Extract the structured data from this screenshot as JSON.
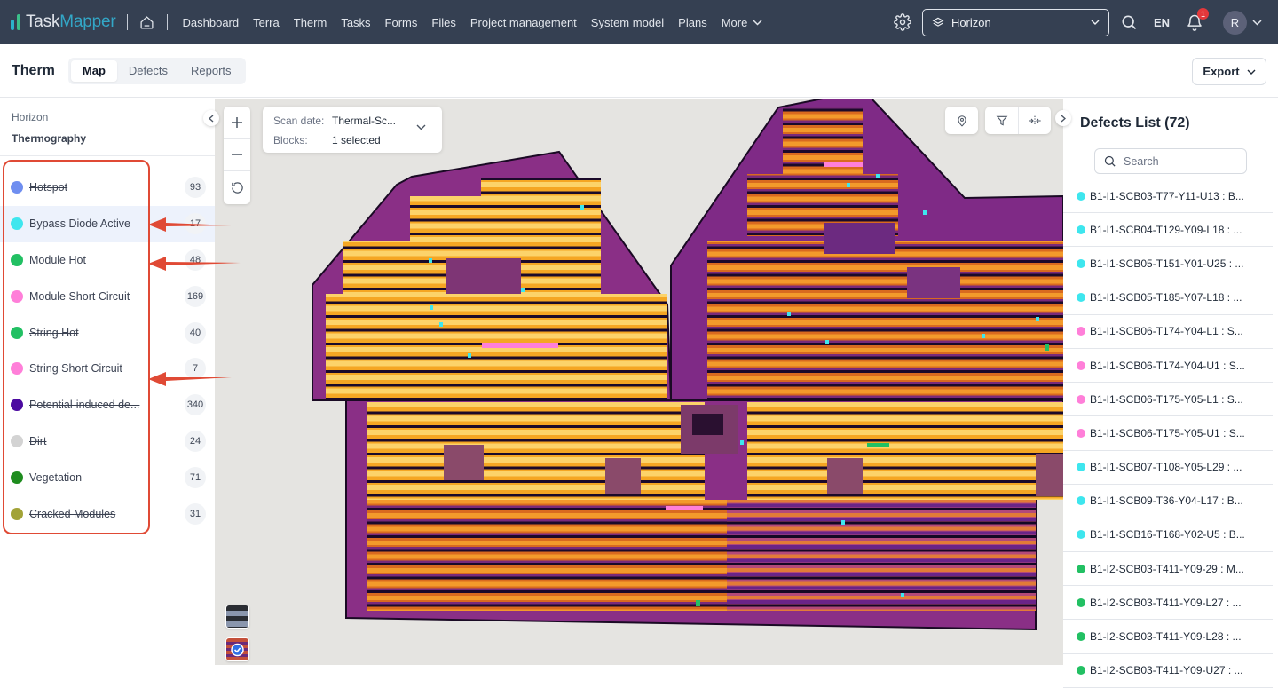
{
  "app": {
    "logo_primary": "Task",
    "logo_accent": "Mapper"
  },
  "nav": {
    "links": [
      "Dashboard",
      "Terra",
      "Therm",
      "Tasks",
      "Forms",
      "Files",
      "Project management",
      "System model",
      "Plans"
    ],
    "more_label": "More",
    "project_selector": "Horizon",
    "language": "EN",
    "notification_count": "1",
    "avatar_initial": "R"
  },
  "subheader": {
    "title": "Therm",
    "tabs": [
      {
        "label": "Map",
        "active": true
      },
      {
        "label": "Defects",
        "active": false
      },
      {
        "label": "Reports",
        "active": false
      }
    ],
    "export_label": "Export"
  },
  "left_panel": {
    "project": "Horizon",
    "module": "Thermography",
    "defect_types": [
      {
        "label": "Hotspot",
        "count": "93",
        "color": "#6f8ef0",
        "enabled": false,
        "highlighted": false
      },
      {
        "label": "Bypass Diode Active",
        "count": "17",
        "color": "#3ee6ee",
        "enabled": true,
        "highlighted": true
      },
      {
        "label": "Module Hot",
        "count": "48",
        "color": "#22c063",
        "enabled": true,
        "highlighted": false
      },
      {
        "label": "Module Short Circuit",
        "count": "169",
        "color": "#ff7fd9",
        "enabled": false,
        "highlighted": false
      },
      {
        "label": "String Hot",
        "count": "40",
        "color": "#22c063",
        "enabled": false,
        "highlighted": false
      },
      {
        "label": "String Short Circuit",
        "count": "7",
        "color": "#ff7fd9",
        "enabled": true,
        "highlighted": false
      },
      {
        "label": "Potential-induced de...",
        "count": "340",
        "color": "#4b0aa0",
        "enabled": false,
        "highlighted": false
      },
      {
        "label": "Dirt",
        "count": "24",
        "color": "#d3d3d3",
        "enabled": false,
        "highlighted": false
      },
      {
        "label": "Vegetation",
        "count": "71",
        "color": "#1e8c1e",
        "enabled": false,
        "highlighted": false
      },
      {
        "label": "Cracked Modules",
        "count": "31",
        "color": "#a2a337",
        "enabled": false,
        "highlighted": false
      }
    ]
  },
  "map": {
    "scan_date_label": "Scan date:",
    "scan_date_value": "Thermal-Sc...",
    "blocks_label": "Blocks:",
    "blocks_value": "1 selected"
  },
  "right_panel": {
    "title": "Defects List (72)",
    "search_placeholder": "Search",
    "defects": [
      {
        "text": "B1-I1-SCB03-T77-Y11-U13 : B...",
        "color": "#3ee6ee"
      },
      {
        "text": "B1-I1-SCB04-T129-Y09-L18 : ...",
        "color": "#3ee6ee"
      },
      {
        "text": "B1-I1-SCB05-T151-Y01-U25 : ...",
        "color": "#3ee6ee"
      },
      {
        "text": "B1-I1-SCB05-T185-Y07-L18 : ...",
        "color": "#3ee6ee"
      },
      {
        "text": "B1-I1-SCB06-T174-Y04-L1 : S...",
        "color": "#ff7fd9"
      },
      {
        "text": "B1-I1-SCB06-T174-Y04-U1 : S...",
        "color": "#ff7fd9"
      },
      {
        "text": "B1-I1-SCB06-T175-Y05-L1 : S...",
        "color": "#ff7fd9"
      },
      {
        "text": "B1-I1-SCB06-T175-Y05-U1 : S...",
        "color": "#ff7fd9"
      },
      {
        "text": "B1-I1-SCB07-T108-Y05-L29 : ...",
        "color": "#3ee6ee"
      },
      {
        "text": "B1-I1-SCB09-T36-Y04-L17 : B...",
        "color": "#3ee6ee"
      },
      {
        "text": "B1-I1-SCB16-T168-Y02-U5 : B...",
        "color": "#3ee6ee"
      },
      {
        "text": "B1-I2-SCB03-T411-Y09-29 : M...",
        "color": "#22c063"
      },
      {
        "text": "B1-I2-SCB03-T411-Y09-L27 : ...",
        "color": "#22c063"
      },
      {
        "text": "B1-I2-SCB03-T411-Y09-L28 : ...",
        "color": "#22c063"
      },
      {
        "text": "B1-I2-SCB03-T411-Y09-U27 : ...",
        "color": "#22c063"
      }
    ]
  },
  "colors": {
    "nav_bg": "#354052",
    "annotation_red": "#e04a35",
    "bypass_diode": "#3ee6ee",
    "module_hot": "#22c063",
    "short_circuit": "#ff7fd9"
  }
}
